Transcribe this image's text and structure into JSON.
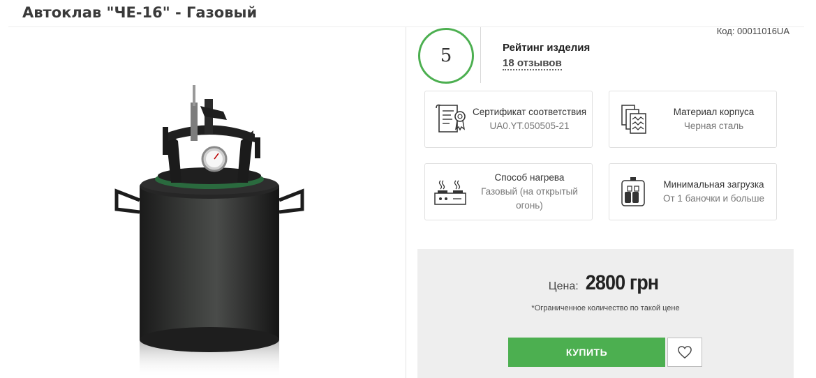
{
  "product": {
    "title": "Автоклав \"ЧЕ-16\" - Газовый",
    "code": "Код: 00011016UA",
    "image_alt": "Автоклав ЧЕ-16 газовый"
  },
  "rating": {
    "value": "5",
    "label": "Рейтинг изделия",
    "reviews": "18 отзывов"
  },
  "features": [
    {
      "icon": "certificate-icon",
      "title": "Сертификат соответствия",
      "value": "UA0.YT.050505-21"
    },
    {
      "icon": "material-icon",
      "title": "Материал корпуса",
      "value": "Черная сталь"
    },
    {
      "icon": "stove-icon",
      "title": "Способ нагрева",
      "value": "Газовый (на открытый огонь)"
    },
    {
      "icon": "jars-icon",
      "title": "Минимальная загрузка",
      "value": "От 1 баночки и больше"
    }
  ],
  "pricing": {
    "label": "Цена:",
    "value": "2800 грн",
    "note": "*Ограниченное количество по такой цене"
  },
  "actions": {
    "buy_label": "КУПИТЬ",
    "favorite_icon": "heart-icon"
  },
  "colors": {
    "accent": "#4caf50",
    "price_box_bg": "#eeeeee"
  }
}
